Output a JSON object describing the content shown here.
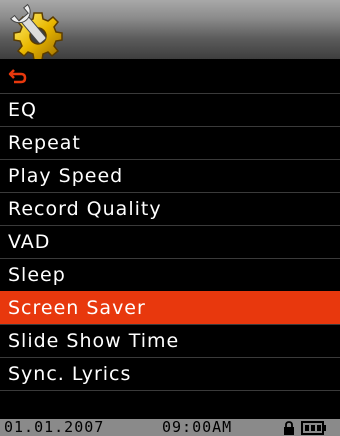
{
  "header": {
    "icon": "settings-wrench-gear-icon"
  },
  "back": {
    "icon": "back-arrow-icon",
    "color": "#e8380d"
  },
  "menu": {
    "items": [
      {
        "label": "EQ"
      },
      {
        "label": "Repeat"
      },
      {
        "label": "Play Speed"
      },
      {
        "label": "Record Quality"
      },
      {
        "label": "VAD"
      },
      {
        "label": "Sleep"
      },
      {
        "label": "Screen Saver"
      },
      {
        "label": "Slide Show Time"
      },
      {
        "label": "Sync. Lyrics"
      }
    ],
    "selected_index": 6,
    "selected_color": "#e8380d"
  },
  "status": {
    "date": "01.01.2007",
    "time": "09:00AM",
    "lock_icon": "lock-icon",
    "battery_icon": "battery-icon"
  }
}
